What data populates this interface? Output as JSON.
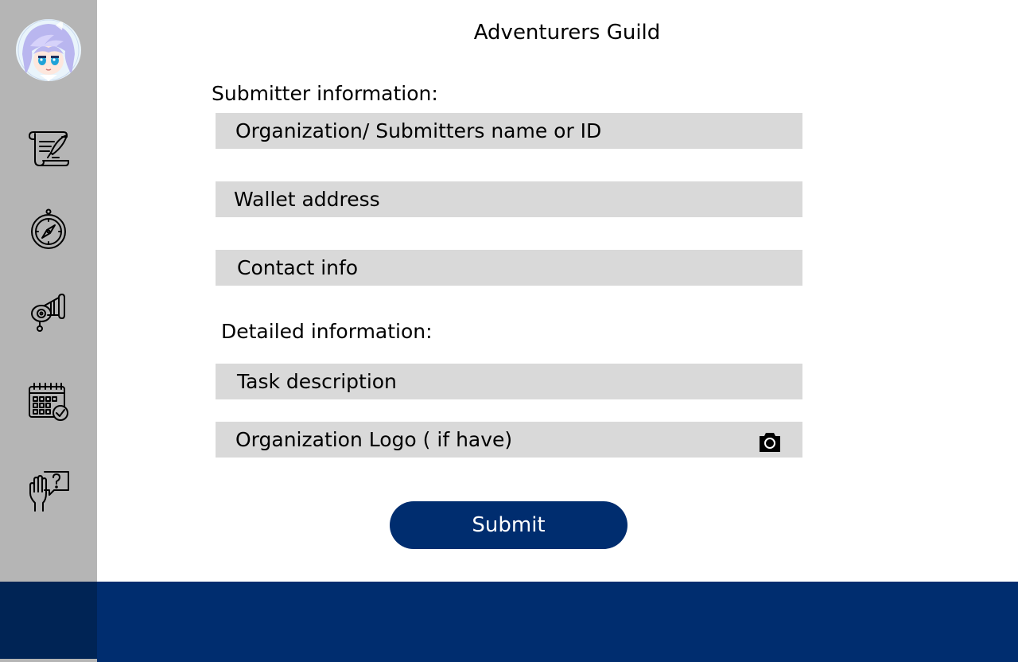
{
  "app": {
    "title": "Adventurers Guild"
  },
  "sidebar": {
    "avatar_icon": "anime-avatar",
    "items": [
      {
        "icon": "scroll-quill-icon"
      },
      {
        "icon": "compass-icon"
      },
      {
        "icon": "horn-icon"
      },
      {
        "icon": "calendar-check-icon"
      },
      {
        "icon": "hand-question-icon"
      }
    ]
  },
  "form": {
    "submitter_heading": "Submitter information:",
    "organization_name": "Organization/ Submitters name or ID",
    "wallet_address": "Wallet address",
    "contact_info": "Contact info",
    "detailed_heading": "Detailed information:",
    "task_description": "Task description",
    "organization_logo": "Organization Logo ( if have)",
    "logo_upload_icon": "camera-icon",
    "submit_label": "Submit"
  },
  "colors": {
    "sidebar": "#b5b5b5",
    "navy": "#002d6f",
    "field": "#d9d9d9"
  }
}
